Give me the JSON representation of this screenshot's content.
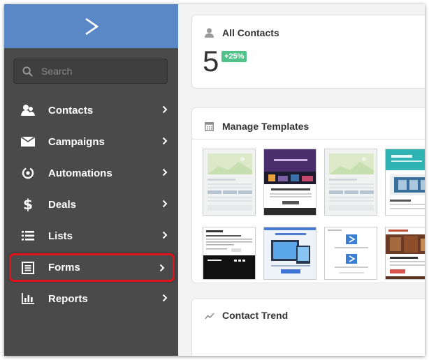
{
  "sidebar": {
    "search_placeholder": "Search",
    "items": [
      {
        "label": "Contacts",
        "icon": "contacts-icon"
      },
      {
        "label": "Campaigns",
        "icon": "envelope-icon"
      },
      {
        "label": "Automations",
        "icon": "automations-icon"
      },
      {
        "label": "Deals",
        "icon": "dollar-icon"
      },
      {
        "label": "Lists",
        "icon": "list-icon"
      },
      {
        "label": "Forms",
        "icon": "forms-icon",
        "highlighted": true
      },
      {
        "label": "Reports",
        "icon": "bar-chart-icon"
      }
    ]
  },
  "widgets": {
    "contacts": {
      "title": "All Contacts",
      "count": "5",
      "change": "+25%"
    },
    "templates": {
      "title": "Manage Templates"
    },
    "trend": {
      "title": "Contact Trend"
    }
  },
  "colors": {
    "brand": "#5a87c6",
    "sidebar": "#4a4a4a",
    "badge": "#4fc28a",
    "highlight": "#e0131b"
  }
}
